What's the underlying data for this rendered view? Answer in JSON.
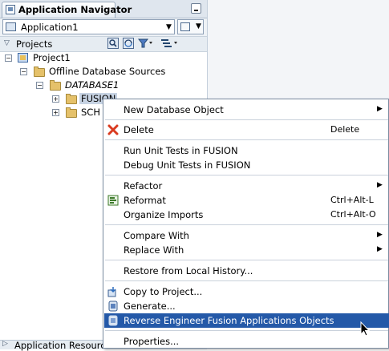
{
  "navigator": {
    "title": "Application Navigator",
    "app_combo_value": "Application1",
    "projects_label": "Projects",
    "tree": {
      "project": "Project1",
      "offline_sources": "Offline Database Sources",
      "database": "DATABASE1",
      "fusion": "FUSION",
      "schema_truncated": "SCH"
    },
    "bottom_section": "Application Resources"
  },
  "context_menu": {
    "items": [
      {
        "label": "New Database Object",
        "mnemonic": "w",
        "submenu": true
      },
      {
        "label": "Delete",
        "mnemonic": "D",
        "shortcut": "Delete",
        "icon": "delete-icon"
      },
      {
        "label": "Run Unit Tests in FUSION"
      },
      {
        "label": "Debug Unit Tests in FUSION"
      },
      {
        "label": "Refactor",
        "submenu": true
      },
      {
        "label": "Reformat",
        "shortcut": "Ctrl+Alt-L",
        "icon": "reformat-icon"
      },
      {
        "label": "Organize Imports",
        "shortcut": "Ctrl+Alt-O"
      },
      {
        "label": "Compare With",
        "submenu": true
      },
      {
        "label": "Replace With",
        "submenu": true
      },
      {
        "label": "Restore from Local History..."
      },
      {
        "label": "Copy to Project...",
        "icon": "copy-to-project-icon"
      },
      {
        "label": "Generate...",
        "icon": "generate-icon"
      },
      {
        "label": "Reverse Engineer Fusion Applications Objects",
        "highlighted": true,
        "icon": "reverse-engineer-icon"
      },
      {
        "label": "Properties..."
      }
    ]
  },
  "colors": {
    "highlight": "#2459a8",
    "delete_icon": "#d93a1f",
    "selection_bg": "#c7d3e3"
  }
}
